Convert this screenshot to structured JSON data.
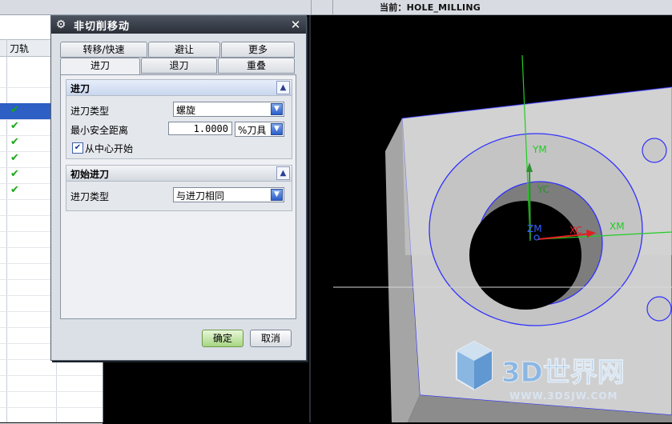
{
  "topbar": {
    "current_operation": "当前：HOLE_MILLING"
  },
  "navigator": {
    "column_title": "刀轨",
    "rows": [
      {
        "check": ""
      },
      {
        "check": ""
      },
      {
        "check": "✔",
        "selected": true
      },
      {
        "check": "✔"
      },
      {
        "check": "✔"
      },
      {
        "check": "✔"
      },
      {
        "check": "✔"
      },
      {
        "check": "✔"
      }
    ]
  },
  "dialog": {
    "title": "非切削移动",
    "tabs_row1": [
      "转移/快速",
      "避让",
      "更多"
    ],
    "tabs_row2": [
      "进刀",
      "退刀",
      "重叠"
    ],
    "active_tab": "进刀",
    "engage_group": {
      "title": "进刀",
      "type_label": "进刀类型",
      "type_value": "螺旋",
      "min_clearance_label": "最小安全距离",
      "min_clearance_value": "1.0000",
      "min_clearance_unit": "%刀具",
      "from_center_label": "从中心开始",
      "from_center_checked": true
    },
    "initial_group": {
      "title": "初始进刀",
      "type_label": "进刀类型",
      "type_value": "与进刀相同"
    },
    "ok_label": "确定",
    "cancel_label": "取消"
  },
  "viewport": {
    "axis_labels": {
      "ym": "YM",
      "yc": "YC",
      "zm": "ZM",
      "xc": "XC",
      "xm": "XM"
    },
    "watermark": {
      "brand": "3D世界网",
      "url": "WWW.3DSJW.COM"
    },
    "colors": {
      "background": "#000000",
      "part": "#c9c9c9",
      "edges": "#3333ff",
      "axis_green": "#22cc22",
      "axis_red": "#e02020"
    }
  }
}
